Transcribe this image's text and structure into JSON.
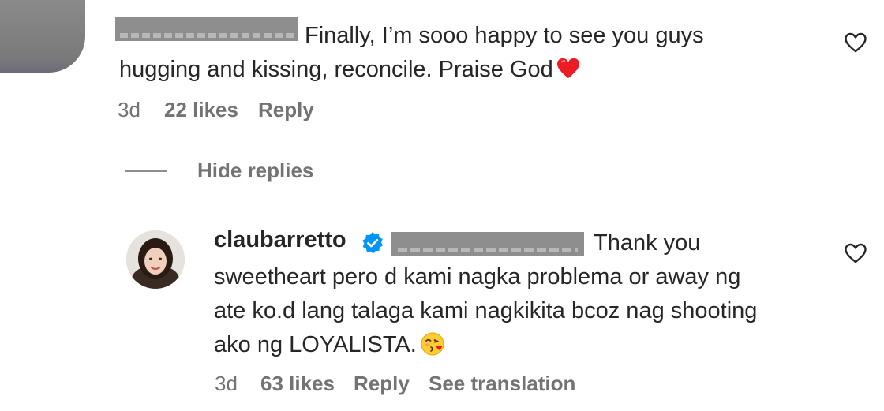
{
  "comment1": {
    "text_line1": "Finally, I’m sooo happy to see you guys",
    "text_line2": "hugging and kissing, reconcile. Praise God",
    "time": "3d",
    "likes": "22 likes",
    "reply_label": "Reply"
  },
  "replies_toggle": {
    "label": "Hide replies"
  },
  "reply1": {
    "username": "claubarretto",
    "text_line1": "Thank you",
    "text_line2": "sweetheart pero d kami nagka problema or away ng",
    "text_line3": "ate ko.d lang talaga kami nagkikita bcoz nag shooting",
    "text_line4": "ako ng LOYALISTA.",
    "time": "3d",
    "likes": "63 likes",
    "reply_label": "Reply",
    "translation_label": "See translation"
  },
  "icons": {
    "like": "heart-outline-icon",
    "verified": "verified-badge-icon",
    "emoji_heart": "red-heart-emoji",
    "emoji_kiss": "face-blowing-kiss-emoji"
  },
  "colors": {
    "text": "#262626",
    "meta": "#737373",
    "verified": "#0095f6",
    "heart": "#ed1c24"
  }
}
